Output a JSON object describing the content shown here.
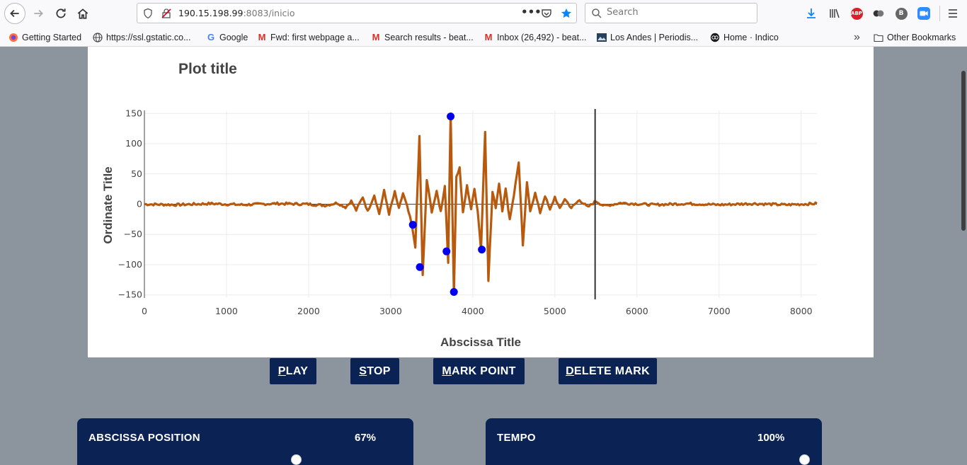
{
  "browser": {
    "url_host": "190.15.198.99",
    "url_rest": ":8083/inicio",
    "search_placeholder": "Search",
    "bookmarks": [
      {
        "label": "Getting Started",
        "icon": "firefox-icon"
      },
      {
        "label": "https://ssl.gstatic.co...",
        "icon": "globe-icon"
      },
      {
        "label": "Google",
        "icon": "google-icon"
      },
      {
        "label": "Fwd: first webpage a...",
        "icon": "gmail-icon"
      },
      {
        "label": "Search results - beat...",
        "icon": "gmail-icon"
      },
      {
        "label": "Inbox (26,492) - beat...",
        "icon": "gmail-icon"
      },
      {
        "label": "Los Andes | Periodis...",
        "icon": "news-icon"
      },
      {
        "label": "Home · Indico",
        "icon": "indico-icon"
      }
    ],
    "other_bookmarks": "Other Bookmarks",
    "extension_abp": "ABP",
    "extension_b": "B"
  },
  "chart_data": {
    "type": "line",
    "title": "Plot title",
    "xlabel": "Abscissa Title",
    "ylabel": "Ordinate Title",
    "xlim": [
      0,
      8192
    ],
    "ylim": [
      -155,
      155
    ],
    "xticks": [
      0,
      1000,
      2000,
      3000,
      4000,
      5000,
      6000,
      7000,
      8000
    ],
    "yticks": [
      150,
      100,
      50,
      0,
      -50,
      -100,
      -150
    ],
    "ytick_labels": [
      "150",
      "100",
      "50",
      "0",
      "−50",
      "−100",
      "−150"
    ],
    "grid": true,
    "line_color": "#b85a0e",
    "marker_color": "#0000ee",
    "cursor_x": 5490,
    "series": [
      {
        "values_xy": [
          [
            0,
            0
          ],
          [
            400,
            -1
          ],
          [
            800,
            1
          ],
          [
            1200,
            -1
          ],
          [
            1600,
            1
          ],
          [
            2000,
            0
          ],
          [
            2200,
            -2
          ],
          [
            2350,
            2
          ],
          [
            2450,
            -5
          ],
          [
            2520,
            5
          ],
          [
            2580,
            -10
          ],
          [
            2660,
            12
          ],
          [
            2720,
            -12
          ],
          [
            2800,
            15
          ],
          [
            2860,
            -16
          ],
          [
            2920,
            22
          ],
          [
            2980,
            -16
          ],
          [
            3050,
            20
          ],
          [
            3100,
            -8
          ],
          [
            3150,
            18
          ],
          [
            3200,
            -4
          ],
          [
            3250,
            -30
          ],
          [
            3300,
            -70
          ],
          [
            3350,
            112
          ],
          [
            3390,
            -118
          ],
          [
            3440,
            40
          ],
          [
            3500,
            -12
          ],
          [
            3560,
            20
          ],
          [
            3610,
            -12
          ],
          [
            3660,
            30
          ],
          [
            3700,
            -95
          ],
          [
            3730,
            148
          ],
          [
            3770,
            -148
          ],
          [
            3800,
            45
          ],
          [
            3840,
            60
          ],
          [
            3880,
            -15
          ],
          [
            3930,
            30
          ],
          [
            3980,
            -8
          ],
          [
            4020,
            25
          ],
          [
            4060,
            -10
          ],
          [
            4100,
            -75
          ],
          [
            4150,
            120
          ],
          [
            4190,
            -125
          ],
          [
            4240,
            20
          ],
          [
            4280,
            -5
          ],
          [
            4320,
            35
          ],
          [
            4360,
            -10
          ],
          [
            4400,
            25
          ],
          [
            4450,
            -25
          ],
          [
            4500,
            15
          ],
          [
            4560,
            70
          ],
          [
            4610,
            -70
          ],
          [
            4660,
            35
          ],
          [
            4700,
            -10
          ],
          [
            4760,
            18
          ],
          [
            4820,
            -14
          ],
          [
            4880,
            14
          ],
          [
            4940,
            -10
          ],
          [
            5000,
            12
          ],
          [
            5060,
            -8
          ],
          [
            5120,
            9
          ],
          [
            5200,
            -6
          ],
          [
            5300,
            7
          ],
          [
            5400,
            -5
          ],
          [
            5500,
            5
          ],
          [
            5600,
            -3
          ],
          [
            5800,
            2
          ],
          [
            6200,
            -1
          ],
          [
            6600,
            1
          ],
          [
            7000,
            -1
          ],
          [
            7400,
            1
          ],
          [
            7800,
            -1
          ],
          [
            8192,
            1
          ]
        ]
      }
    ],
    "marked_points": [
      [
        3270,
        -34
      ],
      [
        3355,
        -104
      ],
      [
        3680,
        -78
      ],
      [
        3730,
        145
      ],
      [
        3770,
        -145
      ],
      [
        4110,
        -75
      ]
    ]
  },
  "controls": {
    "play": {
      "u": "P",
      "rest": "LAY"
    },
    "stop": {
      "u": "S",
      "rest": "TOP"
    },
    "mark": {
      "u": "M",
      "rest": "ARK POINT"
    },
    "delete": {
      "u": "D",
      "rest": "ELETE MARK"
    }
  },
  "panels": {
    "abscissa": {
      "label": "ABSCISSA POSITION",
      "value": "67%",
      "fraction": 0.67
    },
    "tempo": {
      "label": "TEMPO",
      "value": "100%",
      "fraction": 1.0
    }
  }
}
